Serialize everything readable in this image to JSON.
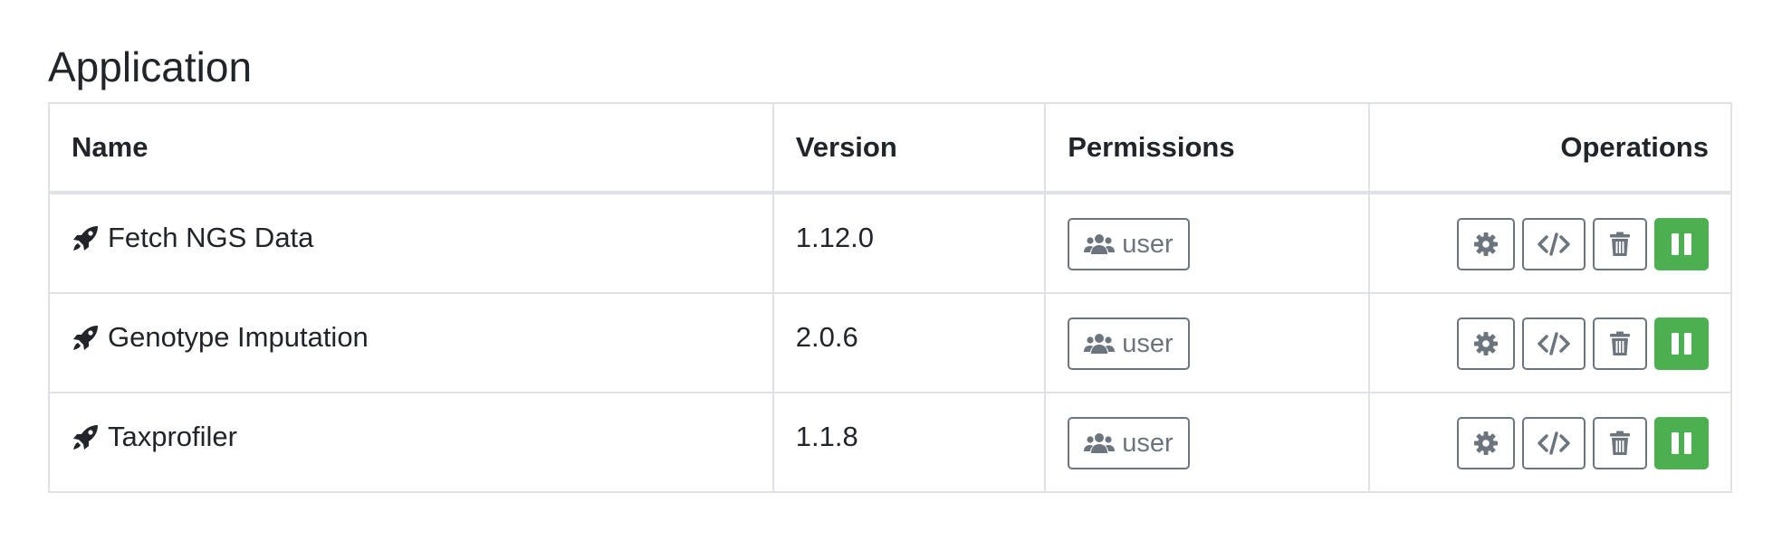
{
  "page": {
    "title": "Application"
  },
  "table": {
    "columns": {
      "name": "Name",
      "version": "Version",
      "permissions": "Permissions",
      "operations": "Operations"
    },
    "rows": [
      {
        "icon": "rocket-icon",
        "name": "Fetch NGS Data",
        "version": "1.12.0",
        "permission": "user"
      },
      {
        "icon": "rocket-icon",
        "name": "Genotype Imputation",
        "version": "2.0.6",
        "permission": "user"
      },
      {
        "icon": "rocket-icon",
        "name": "Taxprofiler",
        "version": "1.1.8",
        "permission": "user"
      }
    ],
    "operations": [
      "gear-icon",
      "code-icon",
      "trash-icon",
      "pause-icon"
    ]
  },
  "colors": {
    "text": "#212529",
    "border": "#dee2e6",
    "secondary": "#6c757d",
    "success": "#4caf50"
  }
}
